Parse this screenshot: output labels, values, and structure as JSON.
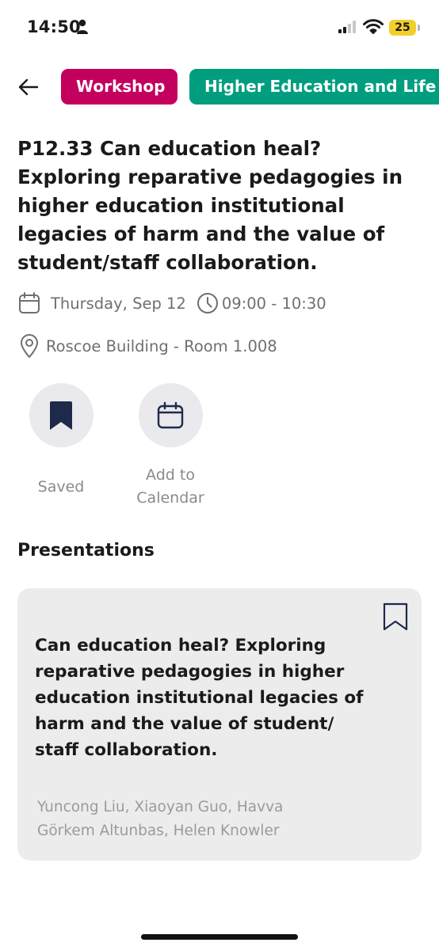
{
  "status_bar": {
    "time": "14:50",
    "battery": "25",
    "icons": [
      "person-icon",
      "signal-icon",
      "wifi-icon",
      "battery-icon"
    ]
  },
  "header": {
    "back_icon": "arrow-left-icon",
    "tags": [
      {
        "label": "Workshop",
        "color": "#c4005e"
      },
      {
        "label": "Higher Education and Life",
        "color": "#009e7e"
      }
    ]
  },
  "event": {
    "title": "P12.33 Can education heal? Exploring reparative pedagogies in higher education institutional legacies of harm and the value of student/staff collaboration.",
    "date": "Thursday, Sep 12",
    "time": "09:00 - 10:30",
    "location": "Roscoe Building - Room 1.008"
  },
  "actions": {
    "saved_label": "Saved",
    "calendar_label": "Add to Calendar",
    "icon_color": "#1e2a4a"
  },
  "presentations": {
    "heading": "Presentations",
    "items": [
      {
        "title": "Can education heal? Exploring reparative pedagogies in higher education institutional legacies of harm and the value of student/ staff collaboration.",
        "authors": "Yuncong Liu, Xiaoyan Guo, Havva Görkem Altunbas, Helen Knowler"
      }
    ]
  }
}
